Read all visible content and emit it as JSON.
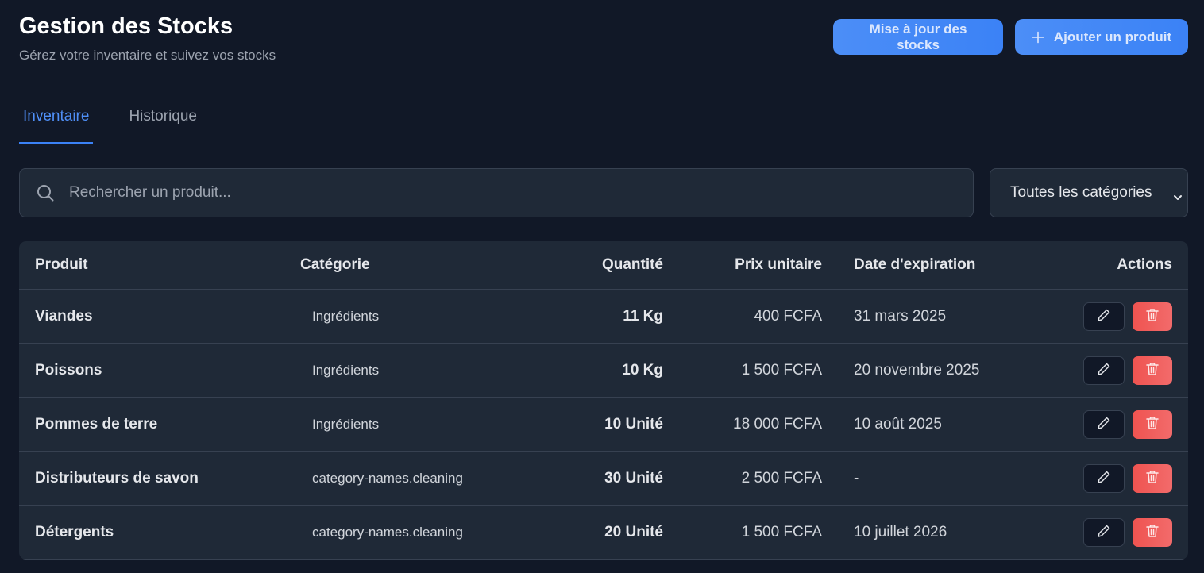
{
  "header": {
    "title": "Gestion des Stocks",
    "subtitle": "Gérez votre inventaire et suivez vos stocks",
    "update_button": "Mise à jour des stocks",
    "add_button": "Ajouter un produit"
  },
  "tabs": [
    {
      "label": "Inventaire",
      "active": true
    },
    {
      "label": "Historique",
      "active": false
    }
  ],
  "search": {
    "placeholder": "Rechercher un produit...",
    "value": ""
  },
  "category_filter": {
    "selected": "Toutes les catégories"
  },
  "table": {
    "columns": [
      "Produit",
      "Catégorie",
      "Quantité",
      "Prix unitaire",
      "Date d'expiration",
      "Actions"
    ],
    "rows": [
      {
        "product": "Viandes",
        "category": "Ingrédients",
        "quantity": "11 Kg",
        "price": "400 FCFA",
        "expiration": "31 mars 2025"
      },
      {
        "product": "Poissons",
        "category": "Ingrédients",
        "quantity": "10 Kg",
        "price": "1 500 FCFA",
        "expiration": "20 novembre 2025"
      },
      {
        "product": "Pommes de terre",
        "category": "Ingrédients",
        "quantity": "10 Unité",
        "price": "18 000 FCFA",
        "expiration": "10 août 2025"
      },
      {
        "product": "Distributeurs de savon",
        "category": "category-names.cleaning",
        "quantity": "30 Unité",
        "price": "2 500 FCFA",
        "expiration": "-"
      },
      {
        "product": "Détergents",
        "category": "category-names.cleaning",
        "quantity": "20 Unité",
        "price": "1 500 FCFA",
        "expiration": "10 juillet 2026"
      }
    ]
  },
  "colors": {
    "background": "#111827",
    "card": "#1f2937",
    "accent": "#3b82f6",
    "danger": "#ef4444"
  },
  "icons": {
    "add": "plus-icon",
    "search": "search-icon",
    "select": "chevron-down-icon",
    "edit": "pencil-icon",
    "delete": "trash-icon"
  }
}
